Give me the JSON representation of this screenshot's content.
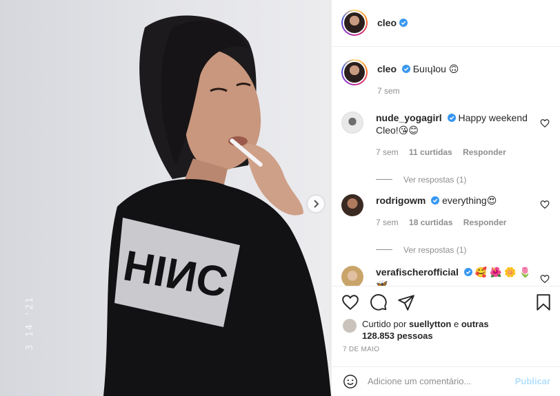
{
  "post": {
    "author": "cleo",
    "verified": true,
    "photo_date_stamp": "3 14 '21"
  },
  "caption": {
    "username": "cleo",
    "text": "Ƃuıɥʇou 🙃",
    "time": "7 sem"
  },
  "comments": [
    {
      "username": "nude_yogagirl",
      "verified": true,
      "text": "Happy weekend Cleo!😘😊",
      "time": "7 sem",
      "likes": "11 curtidas",
      "reply_label": "Responder",
      "view_replies": "Ver respostas (1)"
    },
    {
      "username": "rodrigowm",
      "verified": true,
      "text": "everything😍",
      "time": "7 sem",
      "likes": "18 curtidas",
      "reply_label": "Responder",
      "view_replies": "Ver respostas (1)"
    },
    {
      "username": "verafischerofficial",
      "verified": true,
      "text": "🥰 🌺 🌼 🌷 🦋"
    }
  ],
  "likes": {
    "prefix": "Curtido por",
    "user": "suellytton",
    "connector": "e",
    "others": "outras 128.853 pessoas"
  },
  "post_date": "7 DE MAIO",
  "add_comment": {
    "placeholder": "Adicione um comentário...",
    "publish_label": "Publicar"
  },
  "icons": [
    "heart-icon",
    "comment-icon",
    "share-icon",
    "bookmark-icon",
    "emoji-icon",
    "verified-badge-icon",
    "chevron-right-icon"
  ],
  "colors": {
    "verified": "#3897f0",
    "publish": "#b2dffc",
    "secondary_text": "#8e8e8e"
  }
}
